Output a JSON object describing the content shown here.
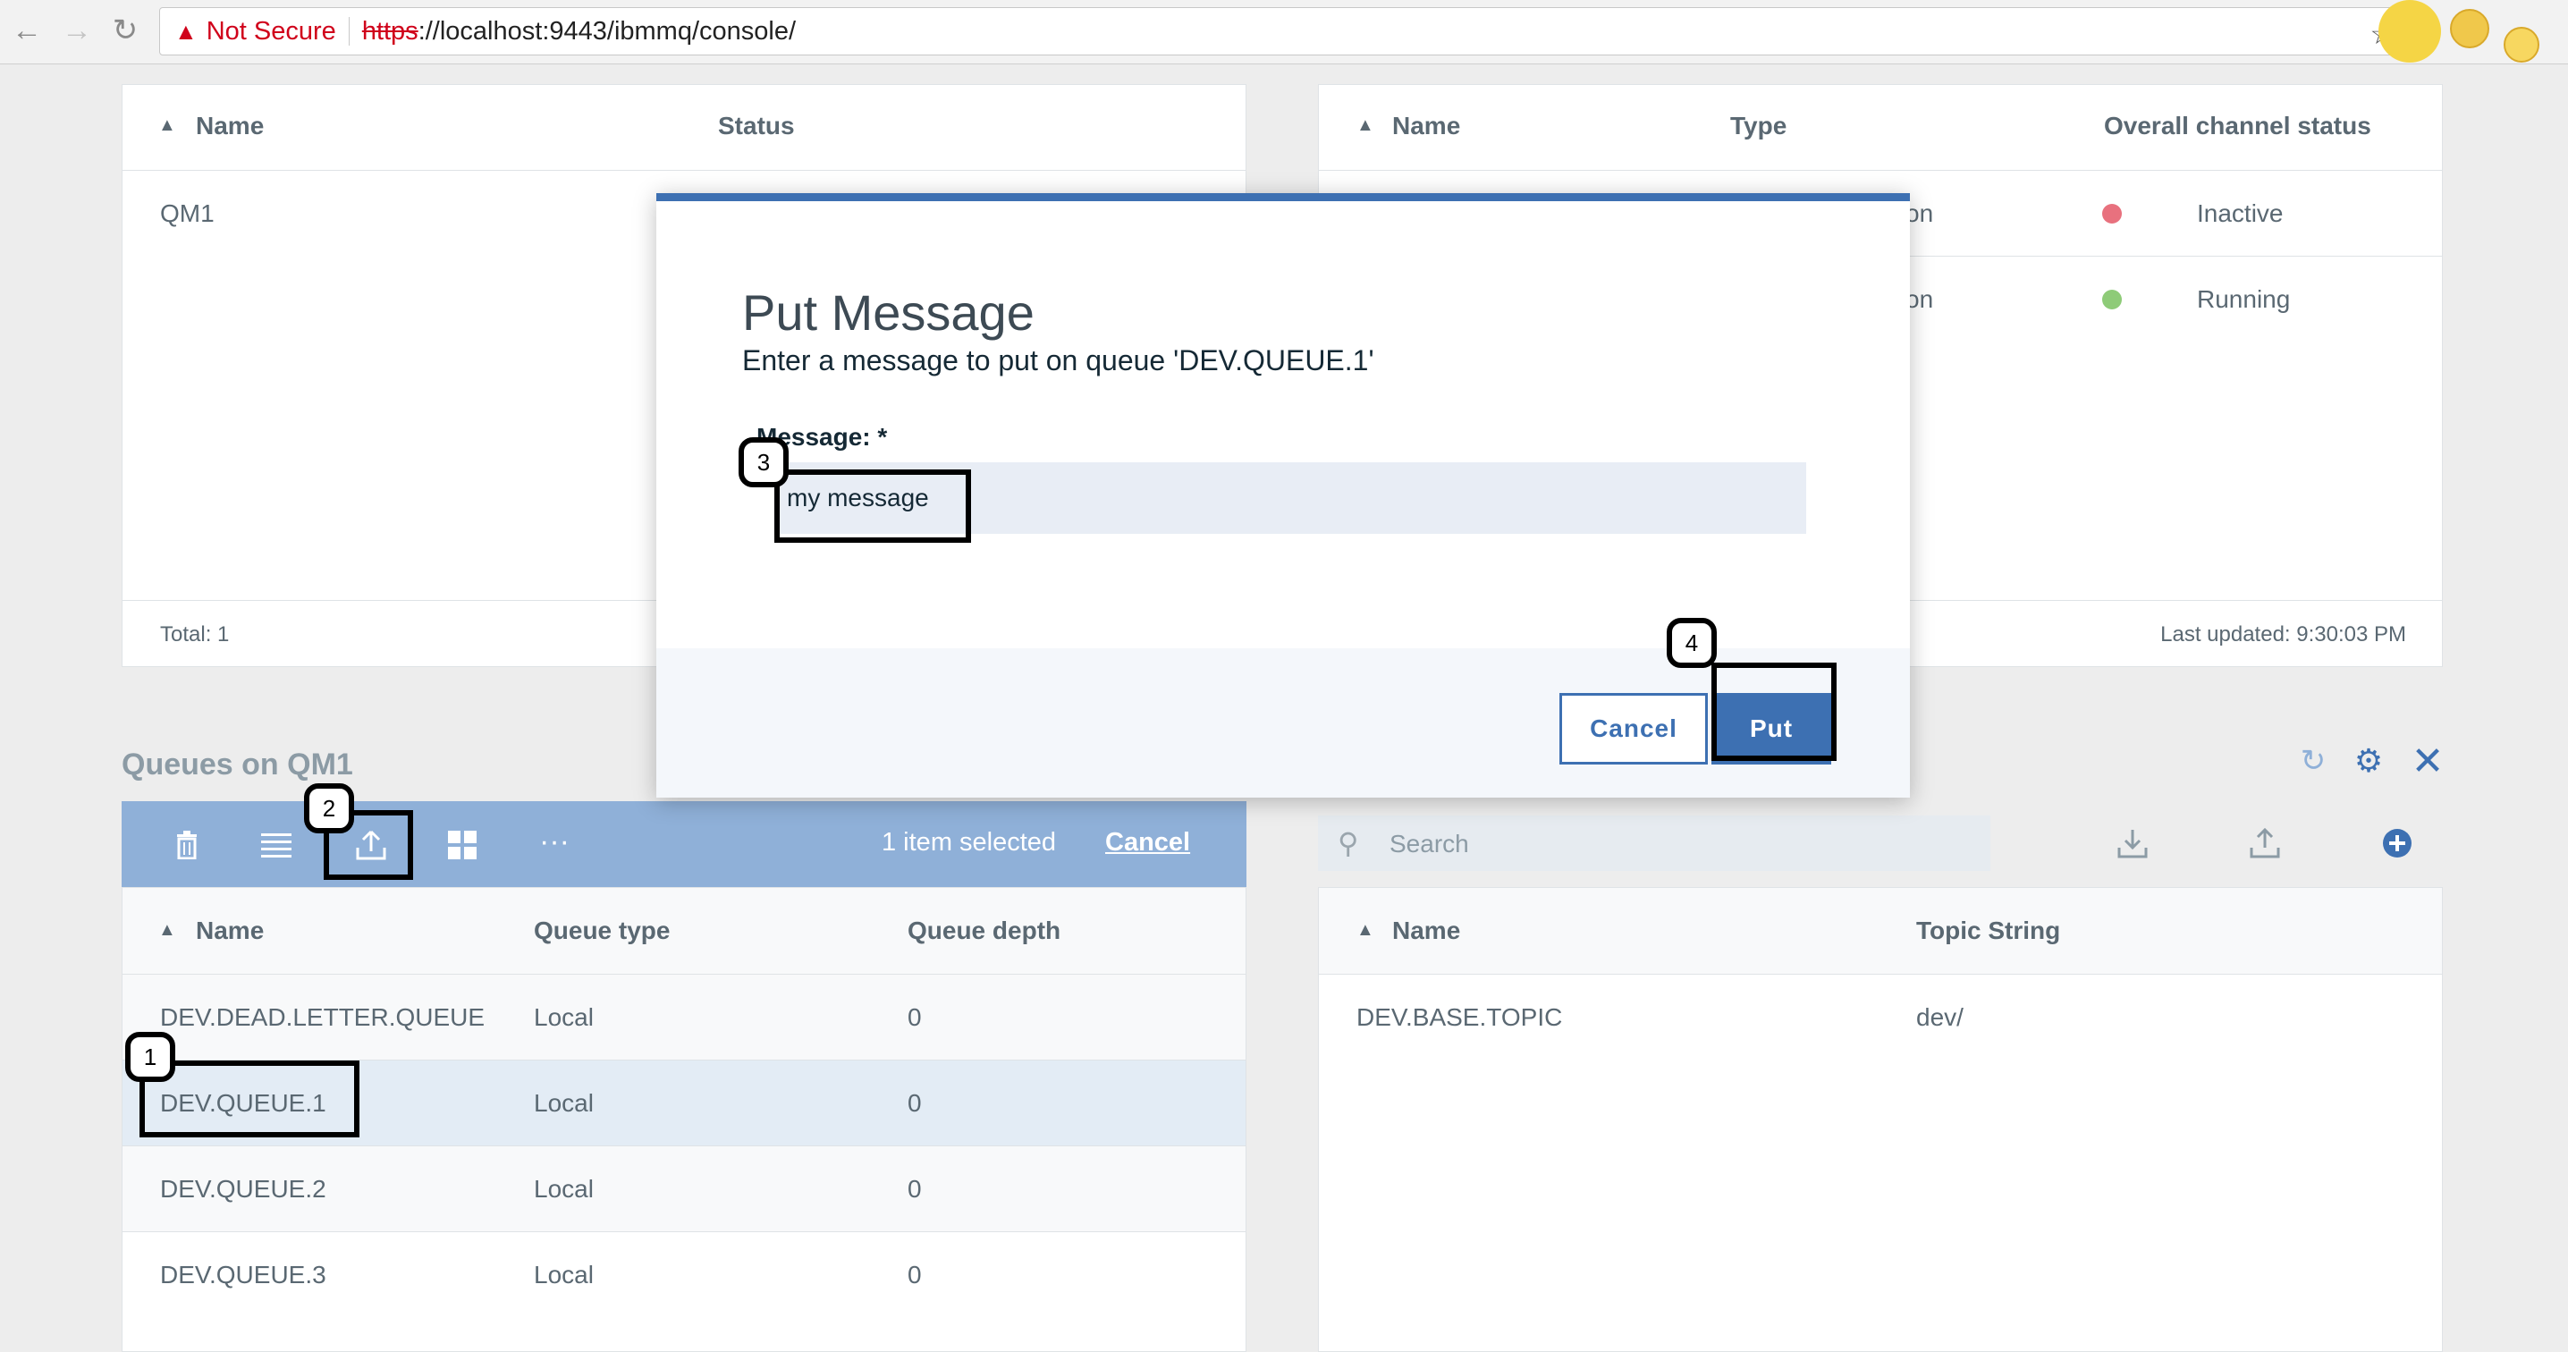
{
  "browser": {
    "not_secure": "Not Secure",
    "url_scheme": "https",
    "url_rest": "://localhost:9443/ibmmq/console/"
  },
  "qm_table": {
    "columns": [
      "Name",
      "Status"
    ],
    "rows": [
      {
        "name": "QM1"
      }
    ],
    "footer": "Total: 1"
  },
  "channel_table": {
    "columns": [
      "Name",
      "Type",
      "Overall channel status"
    ],
    "rows": [
      {
        "type_fragment": "on",
        "status": "Inactive"
      },
      {
        "type_fragment": "on",
        "status": "Running"
      }
    ],
    "footer": "Last updated: 9:30:03 PM"
  },
  "queues": {
    "title": "Queues on QM1",
    "selected_text": "1 item selected",
    "cancel_link": "Cancel",
    "columns": [
      "Name",
      "Queue type",
      "Queue depth"
    ],
    "rows": [
      {
        "name": "DEV.DEAD.LETTER.QUEUE",
        "type": "Local",
        "depth": "0"
      },
      {
        "name": "DEV.QUEUE.1",
        "type": "Local",
        "depth": "0"
      },
      {
        "name": "DEV.QUEUE.2",
        "type": "Local",
        "depth": "0"
      },
      {
        "name": "DEV.QUEUE.3",
        "type": "Local",
        "depth": "0"
      }
    ]
  },
  "topics": {
    "search_placeholder": "Search",
    "columns": [
      "Name",
      "Topic String"
    ],
    "rows": [
      {
        "name": "DEV.BASE.TOPIC",
        "topic_string": "dev/"
      }
    ]
  },
  "modal": {
    "title": "Put Message",
    "subtitle": "Enter a message to put on queue 'DEV.QUEUE.1'",
    "field_label": "Message: *",
    "field_value": "my message",
    "cancel_button": "Cancel",
    "put_button": "Put"
  },
  "callouts": [
    "1",
    "2",
    "3",
    "4"
  ],
  "colors": {
    "accent": "#3d70b2",
    "inactive": "#e8717e",
    "running": "#8ecb78",
    "toolbar": "#8fb0d8",
    "not_secure": "#d0021b"
  }
}
